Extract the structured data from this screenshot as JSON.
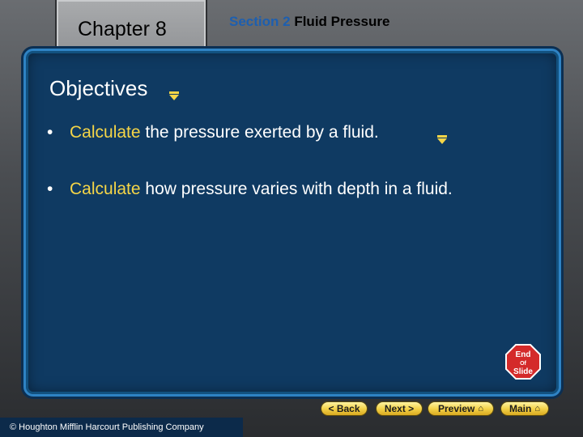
{
  "header": {
    "chapter": "Chapter 8",
    "section_prefix": "Section 2",
    "section_title": "Fluid Pressure"
  },
  "panel": {
    "title": "Objectives",
    "bullets": [
      {
        "marker": "•",
        "keyword": "Calculate",
        "text": "the pressure exerted by a fluid."
      },
      {
        "marker": "•",
        "keyword": "Calculate",
        "text": "how pressure varies with depth in a fluid."
      }
    ],
    "end_of_slide": {
      "line1": "End",
      "line2": "Of",
      "line3": "Slide"
    }
  },
  "nav": {
    "back": "< Back",
    "next": "Next >",
    "preview": "Preview",
    "main": "Main"
  },
  "footer": {
    "copyright": "© Houghton Mifflin Harcourt Publishing Company"
  },
  "colors": {
    "accent": "#f5d547",
    "panel": "#0f3a62",
    "section_accent": "#1d5fb0"
  }
}
